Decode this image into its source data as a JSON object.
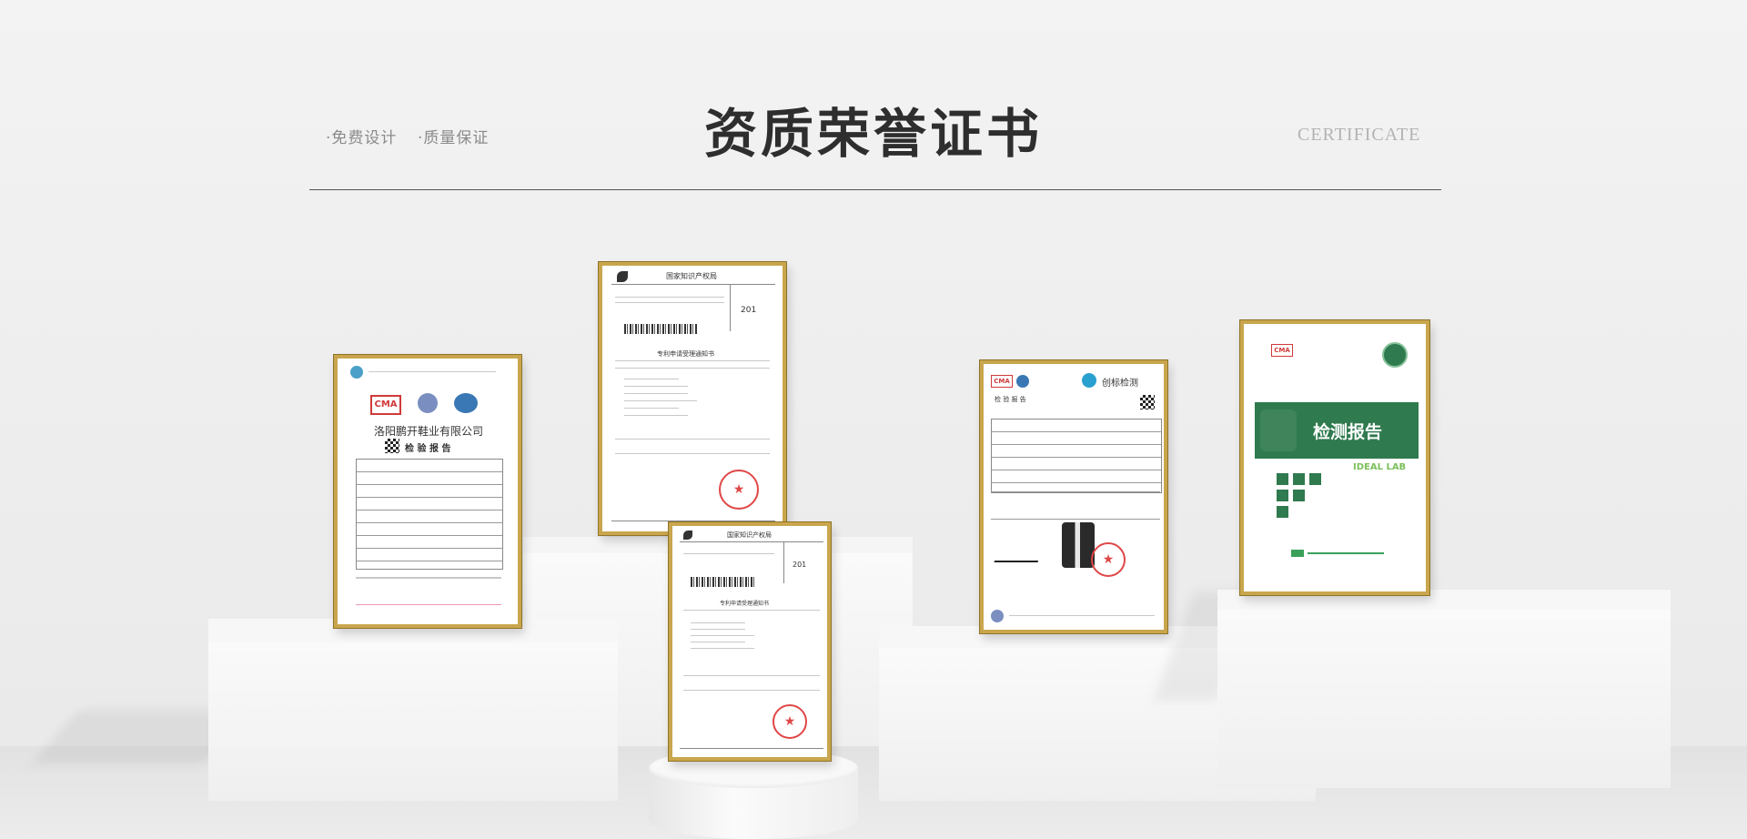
{
  "header": {
    "tag1": "·免费设计",
    "tag2": "·质量保证",
    "title": "资质荣誉证书",
    "subtitle_en": "CERTIFICATE"
  },
  "certificates": [
    {
      "id": "cert-1",
      "org": "洛阳鹏开鞋业有限公司",
      "doc_title": "检 验 报 告",
      "logos": [
        "CMA",
        "ilac-MRA",
        "CNAS"
      ]
    },
    {
      "id": "cert-2",
      "doc_title": "国家知识产权局",
      "section": "专利申请受理通知书",
      "code": "201"
    },
    {
      "id": "cert-3",
      "doc_title": "国家知识产权局",
      "section": "专利申请受理通知书",
      "code": "201"
    },
    {
      "id": "cert-4",
      "brand": "创标检测",
      "doc_title": "检 验 报 告",
      "logos": [
        "CMA",
        "CNAS"
      ]
    },
    {
      "id": "cert-5",
      "logo": "CMA",
      "banner": "检测报告",
      "banner_subtitle": "IDEAL LAB"
    }
  ],
  "colors": {
    "frame_gold": "#c9a64d",
    "seal_red": "#e04646",
    "report_green": "#2f7a4e",
    "title": "#2e2e2e"
  }
}
